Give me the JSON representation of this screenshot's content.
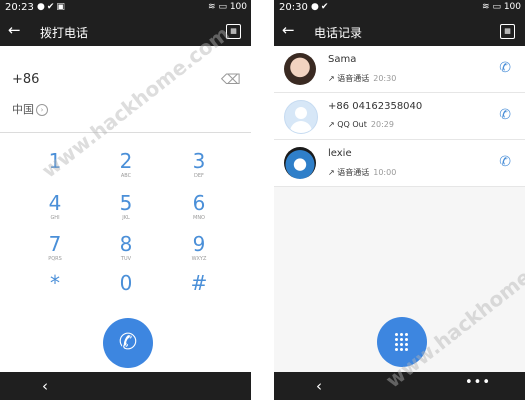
{
  "left": {
    "status_time": "20:23",
    "battery": "100",
    "title": "拨打电话",
    "number": "+86",
    "country": "中国",
    "keys": [
      {
        "digit": "1",
        "letters": ""
      },
      {
        "digit": "2",
        "letters": "ABC"
      },
      {
        "digit": "3",
        "letters": "DEF"
      },
      {
        "digit": "4",
        "letters": "GHI"
      },
      {
        "digit": "5",
        "letters": "JKL"
      },
      {
        "digit": "6",
        "letters": "MNO"
      },
      {
        "digit": "7",
        "letters": "PQRS"
      },
      {
        "digit": "8",
        "letters": "TUV"
      },
      {
        "digit": "9",
        "letters": "WXYZ"
      },
      {
        "digit": "*",
        "letters": ""
      },
      {
        "digit": "0",
        "letters": ""
      },
      {
        "digit": "#",
        "letters": ""
      }
    ]
  },
  "right": {
    "status_time": "20:30",
    "battery": "100",
    "title": "电话记录",
    "entries": [
      {
        "name": "Sama",
        "type": "语音通话",
        "time": "20:30"
      },
      {
        "name": "+86 04162358040",
        "type": "QQ Out",
        "time": "20:29"
      },
      {
        "name": "lexie",
        "type": "语音通话",
        "time": "10:00"
      }
    ]
  },
  "icons": {
    "back": "back-arrow-icon",
    "sim": "sim-card-icon",
    "backspace": "backspace-icon",
    "call": "phone-icon",
    "dialpad": "dialpad-icon",
    "more": "more-icon"
  },
  "colors": {
    "accent": "#3d86e0",
    "bar": "#1f1f1f"
  },
  "watermark": "www.hackhome.com"
}
